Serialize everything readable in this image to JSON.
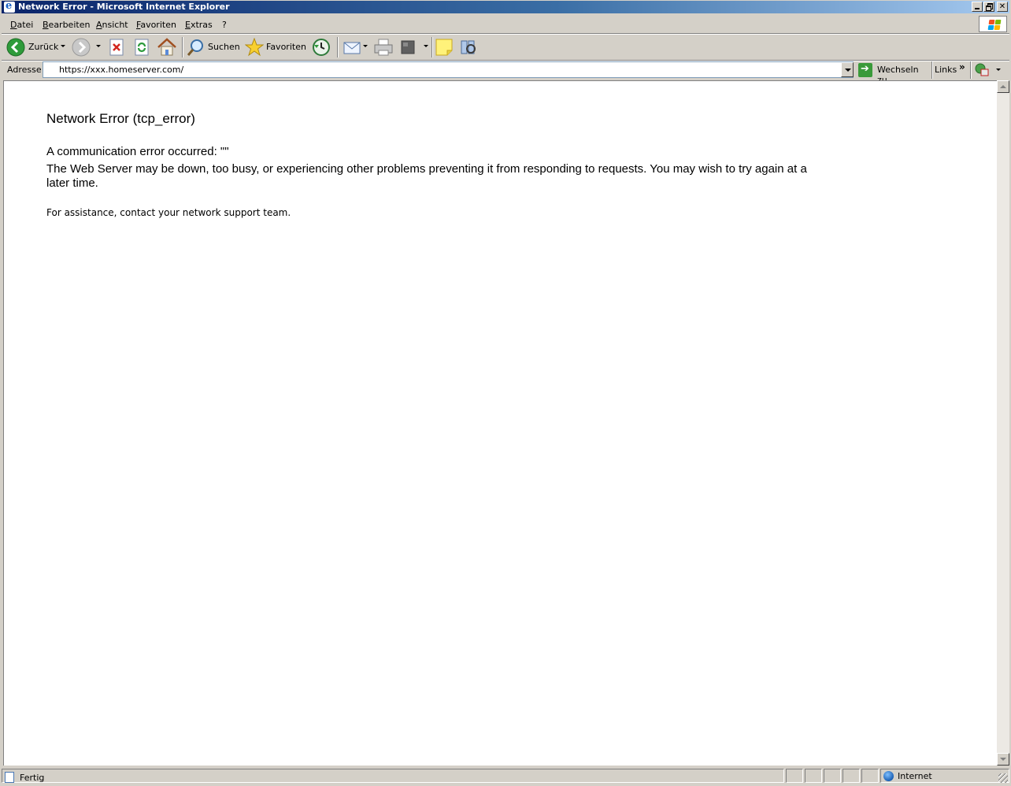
{
  "window": {
    "title": "Network Error - Microsoft Internet Explorer"
  },
  "menu": {
    "items": [
      "Datei",
      "Bearbeiten",
      "Ansicht",
      "Favoriten",
      "Extras",
      "?"
    ]
  },
  "toolbar": {
    "back_label": "Zurück",
    "search_label": "Suchen",
    "favorites_label": "Favoriten"
  },
  "address": {
    "label": "Adresse",
    "url": "https://xxx.homeserver.com/",
    "go_label": "Wechseln zu",
    "links_label": "Links",
    "links_chevron": "»"
  },
  "page": {
    "title": "Network Error (tcp_error)",
    "line1": "A communication error occurred: \"\"",
    "line2": "The Web Server may be down, too busy, or experiencing other problems preventing it from responding to requests. You may wish to try again at a later time.",
    "assist": "For assistance, contact your network support team."
  },
  "status": {
    "text": "Fertig",
    "zone": "Internet"
  },
  "icons": {
    "back": "back-arrow-icon",
    "forward": "forward-arrow-icon",
    "stop": "stop-icon",
    "refresh": "refresh-icon",
    "home": "home-icon",
    "search": "search-magnifier-icon",
    "favorites": "favorites-star-icon",
    "history": "history-icon",
    "mail": "mail-icon",
    "print": "print-icon",
    "edit": "edit-icon",
    "notes": "notes-icon",
    "research": "research-icon"
  },
  "colors": {
    "titlebar_start": "#0a246a",
    "titlebar_end": "#a6caf0",
    "chrome": "#d4d0c8"
  }
}
